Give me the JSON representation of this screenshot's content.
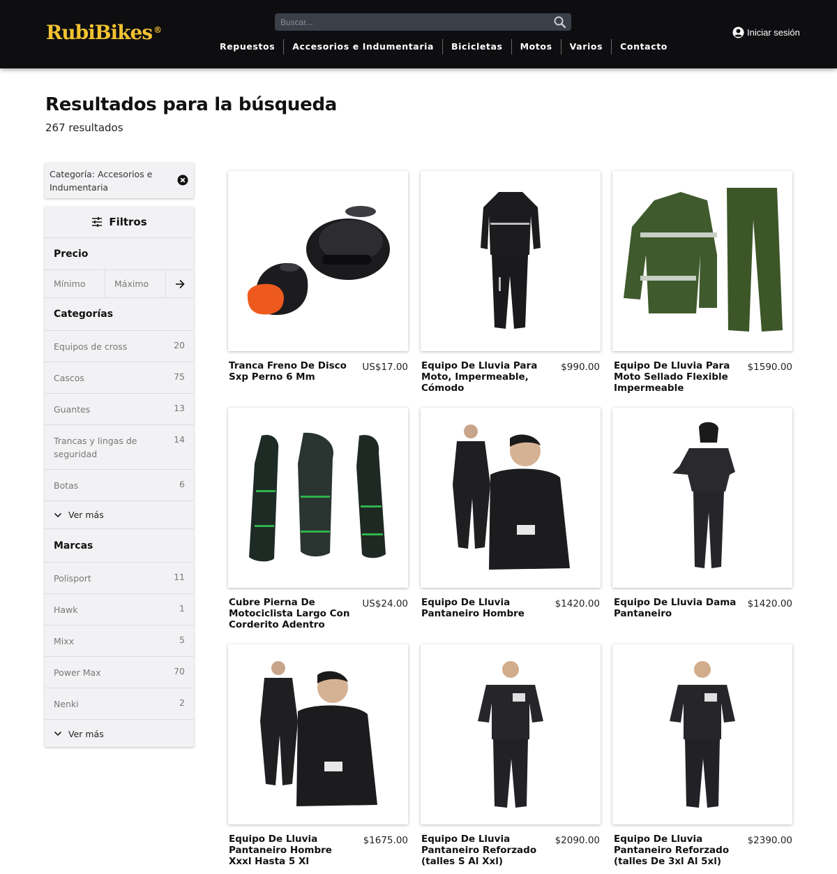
{
  "header": {
    "brand": "RubiBikes",
    "brand_mark": "®",
    "search_placeholder": "Buscar...",
    "nav": [
      "Repuestos",
      "Accesorios e Indumentaria",
      "Bicicletas",
      "Motos",
      "Varios",
      "Contacto"
    ],
    "login_label": "Iniciar sesión"
  },
  "page": {
    "title": "Resultados para la búsqueda",
    "count": "267 resultados"
  },
  "active_filter": {
    "label": "Categoría: Accesorios e Indumentaria"
  },
  "filters": {
    "title": "Filtros",
    "price_title": "Precio",
    "min_placeholder": "Mínimo",
    "max_placeholder": "Máximo",
    "categories_title": "Categorías",
    "categories": [
      {
        "label": "Equipos de cross",
        "count": "20"
      },
      {
        "label": "Cascos",
        "count": "75"
      },
      {
        "label": "Guantes",
        "count": "13"
      },
      {
        "label": "Trancas y lingas de seguridad",
        "count": "14"
      },
      {
        "label": "Botas",
        "count": "6"
      }
    ],
    "see_more": "Ver más",
    "brands_title": "Marcas",
    "brands": [
      {
        "label": "Polisport",
        "count": "11"
      },
      {
        "label": "Hawk",
        "count": "1"
      },
      {
        "label": "Mixx",
        "count": "5"
      },
      {
        "label": "Power Max",
        "count": "70"
      },
      {
        "label": "Nenki",
        "count": "2"
      }
    ]
  },
  "products": [
    {
      "name": "Tranca Freno De Disco Sxp Perno 6 Mm",
      "price": "US$17.00",
      "icon": "disc-lock-image"
    },
    {
      "name": "Equipo De Lluvia Para Moto, Impermeable, Cómodo",
      "price": "$990.00",
      "icon": "rain-suit-image"
    },
    {
      "name": "Equipo De Lluvia Para Moto Sellado Flexible Impermeable",
      "price": "$1590.00",
      "icon": "green-rain-suit-image"
    },
    {
      "name": "Cubre Pierna De Motociclista Largo Con Corderito Adentro",
      "price": "US$24.00",
      "icon": "leg-cover-image"
    },
    {
      "name": "Equipo De Lluvia Pantaneiro Hombre",
      "price": "$1420.00",
      "icon": "rain-suit-man-image"
    },
    {
      "name": "Equipo De Lluvia Dama Pantaneiro",
      "price": "$1420.00",
      "icon": "rain-suit-woman-image"
    },
    {
      "name": "Equipo De Lluvia Pantaneiro Hombre Xxxl Hasta 5 Xl",
      "price": "$1675.00",
      "icon": "rain-suit-man-image"
    },
    {
      "name": "Equipo De Lluvia Pantaneiro Reforzado (talles S Al Xxl)",
      "price": "$2090.00",
      "icon": "rain-suit-reinforced-image"
    },
    {
      "name": "Equipo De Lluvia Pantaneiro Reforzado (talles De 3xl Al 5xl)",
      "price": "$2390.00",
      "icon": "rain-suit-reinforced-image"
    }
  ],
  "colors": {
    "header_bg": "#0e0e10",
    "brand_yellow": "#f2c230",
    "panel_bg": "#f2f2f4"
  }
}
